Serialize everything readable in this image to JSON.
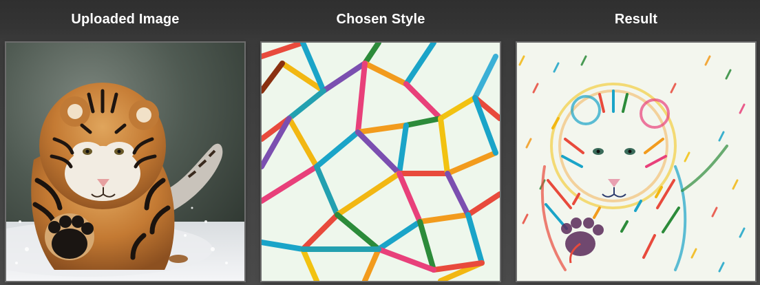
{
  "panels": [
    {
      "title": "Uploaded Image"
    },
    {
      "title": "Chosen Style"
    },
    {
      "title": "Result"
    }
  ]
}
